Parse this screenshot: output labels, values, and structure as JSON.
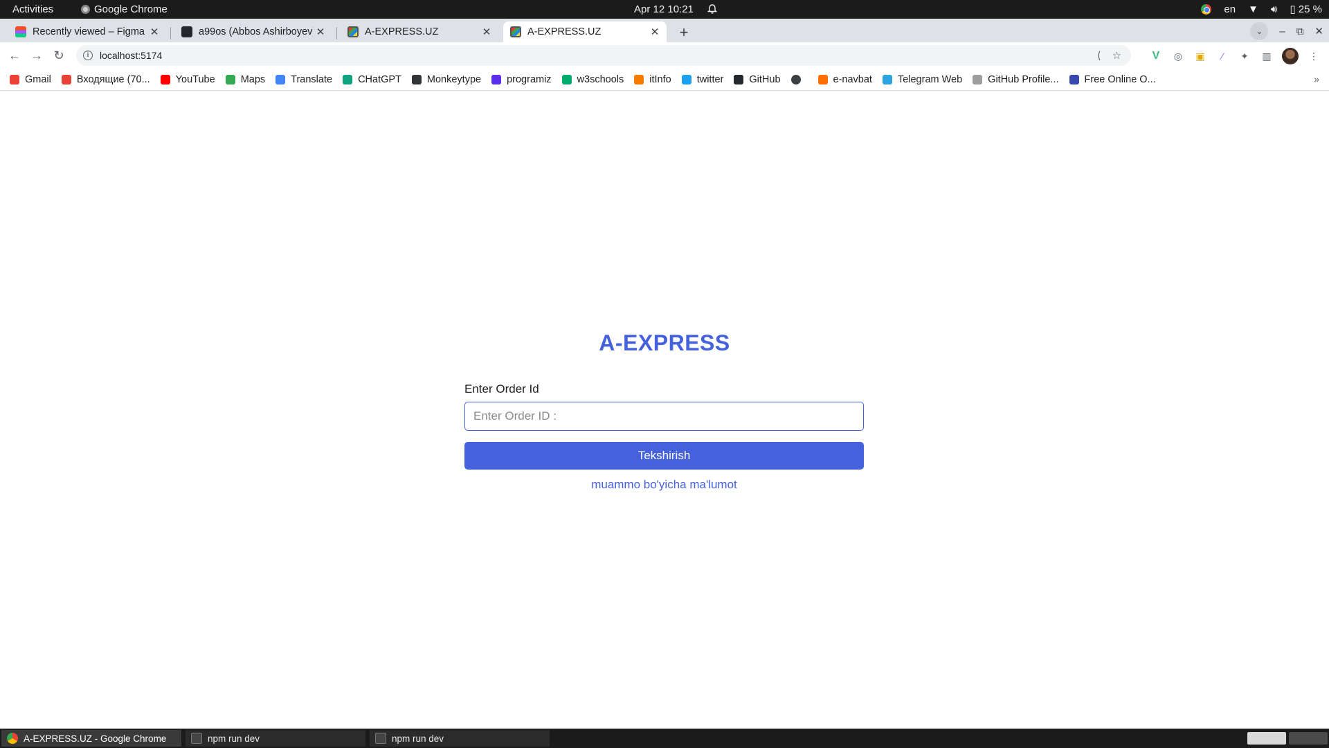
{
  "system": {
    "activities": "Activities",
    "app_name": "Google Chrome",
    "clock": "Apr 12  10:21",
    "language": "en",
    "battery": "25 %"
  },
  "tabs": [
    {
      "title": "Recently viewed – Figma",
      "favicon": "figma-icon",
      "active": false
    },
    {
      "title": "a99os (Abbos Ashirboyev)",
      "favicon": "github-icon",
      "active": false
    },
    {
      "title": "A-EXPRESS.UZ",
      "favicon": "site-icon",
      "active": false
    },
    {
      "title": "A-EXPRESS.UZ",
      "favicon": "site-icon",
      "active": true
    }
  ],
  "omnibox": {
    "url": "localhost:5174"
  },
  "bookmarks": [
    {
      "label": "Gmail",
      "color": "#ea4335"
    },
    {
      "label": "Входящие (70...",
      "color": "#ea4335"
    },
    {
      "label": "YouTube",
      "color": "#ff0000"
    },
    {
      "label": "Maps",
      "color": "#34a853"
    },
    {
      "label": "Translate",
      "color": "#4285f4"
    },
    {
      "label": "CHatGPT",
      "color": "#10a37f"
    },
    {
      "label": "Monkeytype",
      "color": "#323437"
    },
    {
      "label": "programiz",
      "color": "#5b2ee8"
    },
    {
      "label": "w3schools",
      "color": "#04aa6d"
    },
    {
      "label": "itInfo",
      "color": "#f57c00"
    },
    {
      "label": "twitter",
      "color": "#1da1f2"
    },
    {
      "label": "GitHub",
      "color": "#24292f"
    },
    {
      "label": "",
      "color": "#3c4043"
    },
    {
      "label": "e-navbat",
      "color": "#ff6f00"
    },
    {
      "label": "Telegram Web",
      "color": "#2aa3df"
    },
    {
      "label": "GitHub Profile...",
      "color": "#9e9e9e"
    },
    {
      "label": "Free Online O...",
      "color": "#3949ab"
    }
  ],
  "page": {
    "brand": "A-EXPRESS",
    "order_label": "Enter Order Id",
    "order_placeholder": "Enter Order ID :",
    "order_value": "",
    "submit_label": "Tekshirish",
    "help_link": "muammo bo'yicha ma'lumot",
    "accent_color": "#4562dc"
  },
  "taskbar": [
    {
      "label": "A-EXPRESS.UZ - Google Chrome",
      "icon": "chrome-icon",
      "active": true
    },
    {
      "label": "npm run dev",
      "icon": "terminal-icon",
      "active": false
    },
    {
      "label": "npm run dev",
      "icon": "terminal-icon",
      "active": false
    }
  ]
}
